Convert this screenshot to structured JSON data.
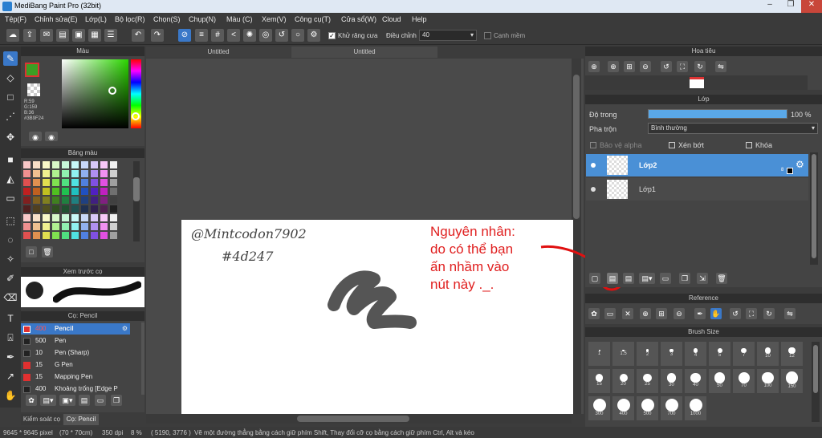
{
  "window": {
    "title": "MediBang Paint Pro (32bit)"
  },
  "menu": [
    "Tệp(F)",
    "Chỉnh sửa(E)",
    "Lớp(L)",
    "Bộ lọc(R)",
    "Chọn(S)",
    "Chụp(N)",
    "Màu (C)",
    "Xem(V)",
    "Công cụ(T)",
    "Cửa sổ(W)",
    "Cloud",
    "Help"
  ],
  "toolbar": {
    "antialias_label": "Khử răng cưa",
    "adjust_label": "Điều chỉnh",
    "adjust_value": "40",
    "soft_edge_label": "Cạnh mềm"
  },
  "panels": {
    "color": "Màu",
    "palette": "Bảng màu",
    "brush_preview": "Xem trước cọ",
    "brush_list": "Cọ: Pencil",
    "navigator": "Hoa tiêu",
    "layer": "Lớp",
    "reference": "Reference",
    "brush_size": "Brush Size"
  },
  "color": {
    "r": "R:59",
    "g": "G:159",
    "b": "B:36",
    "hex": "#3B9F24",
    "fg": "#3B9F24"
  },
  "tabs": [
    "Untitled",
    "Untitled"
  ],
  "brushes": [
    {
      "size": "400",
      "name": "Pencil",
      "color": "#e03030"
    },
    {
      "size": "500",
      "name": "Pen",
      "color": "#222222"
    },
    {
      "size": "10",
      "name": "Pen (Sharp)",
      "color": "#222222"
    },
    {
      "size": "15",
      "name": "G Pen",
      "color": "#e03030"
    },
    {
      "size": "15",
      "name": "Mapping Pen",
      "color": "#e03030"
    },
    {
      "size": "400",
      "name": "Khoảng trống [Edge P",
      "color": "#222222"
    }
  ],
  "bottom_tabs": [
    "Kiểm soát cọ",
    "Cọ: Pencil"
  ],
  "layer": {
    "opacity_label": "Độ trong",
    "opacity_value": "100 %",
    "opacity": 1.0,
    "blend_label": "Pha trộn",
    "blend_value": "Bình thường",
    "protect_alpha": "Bảo vệ alpha",
    "clipping": "Xén bớt",
    "lock": "Khóa",
    "layers": [
      {
        "name": "Lớp2",
        "num": "8"
      },
      {
        "name": "Lớp1"
      }
    ]
  },
  "canvas": {
    "handwriting_1": "@Mintcodon7902",
    "handwriting_2": "#4d247",
    "note": "Nguyên nhân:\ndo có thể bạn\nấn nhầm vào\nnút này ._."
  },
  "brush_sizes": [
    "1",
    "1.5",
    "2",
    "3",
    "4",
    "5",
    "7",
    "10",
    "12",
    "15",
    "20",
    "25",
    "30",
    "40",
    "50",
    "70",
    "100",
    "150",
    "300",
    "400",
    "500",
    "700",
    "1000"
  ],
  "status": {
    "size": "9645 * 9645 pixel",
    "cm": "(70 * 70cm)",
    "dpi": "350 dpi",
    "zoom": "8 %",
    "coords": "( 5190, 3776 )",
    "hint": "Vẽ một đường thẳng bằng cách giữ phím Shift, Thay đổi cỡ cọ bằng cách giữ phím Ctrl, Alt và kéo"
  }
}
